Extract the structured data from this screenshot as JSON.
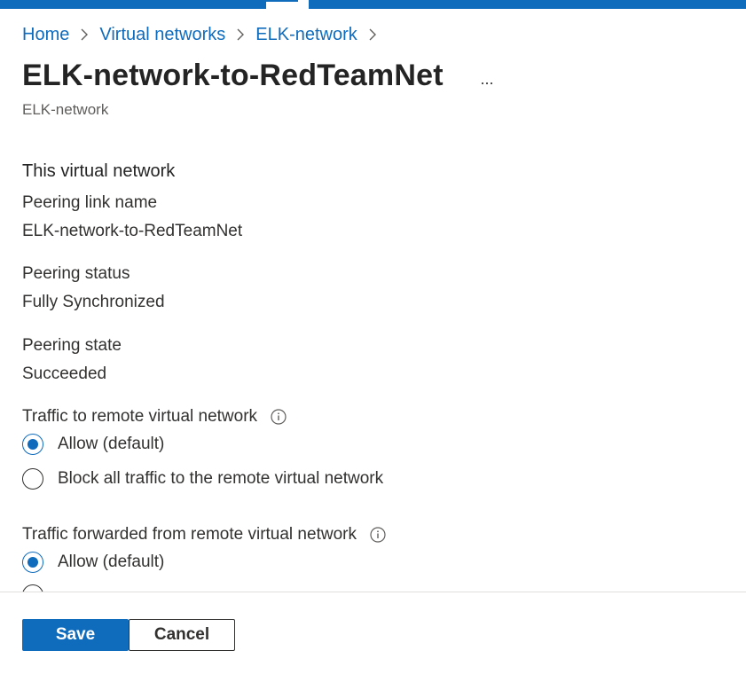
{
  "breadcrumb": [
    "Home",
    "Virtual networks",
    "ELK-network"
  ],
  "page": {
    "title": "ELK-network-to-RedTeamNet",
    "more_label": "...",
    "subtitle": "ELK-network"
  },
  "section": {
    "heading": "This virtual network",
    "fields": [
      {
        "label": "Peering link name",
        "value": "ELK-network-to-RedTeamNet"
      },
      {
        "label": "Peering status",
        "value": "Fully Synchronized"
      },
      {
        "label": "Peering state",
        "value": "Succeeded"
      }
    ]
  },
  "traffic_to_remote": {
    "label": "Traffic to remote virtual network",
    "options": [
      "Allow (default)",
      "Block all traffic to the remote virtual network"
    ],
    "selected": 0
  },
  "traffic_forwarded": {
    "label": "Traffic forwarded from remote virtual network",
    "options": [
      "Allow (default)"
    ],
    "selected": 0
  },
  "footer": {
    "save_label": "Save",
    "cancel_label": "Cancel"
  },
  "colors": {
    "accent": "#0f6cbd",
    "text": "#323130",
    "muted": "#605e5c"
  },
  "icons": {
    "breadcrumb_separator": "chevron-right-icon",
    "info": "info-icon",
    "more": "ellipsis-icon"
  }
}
